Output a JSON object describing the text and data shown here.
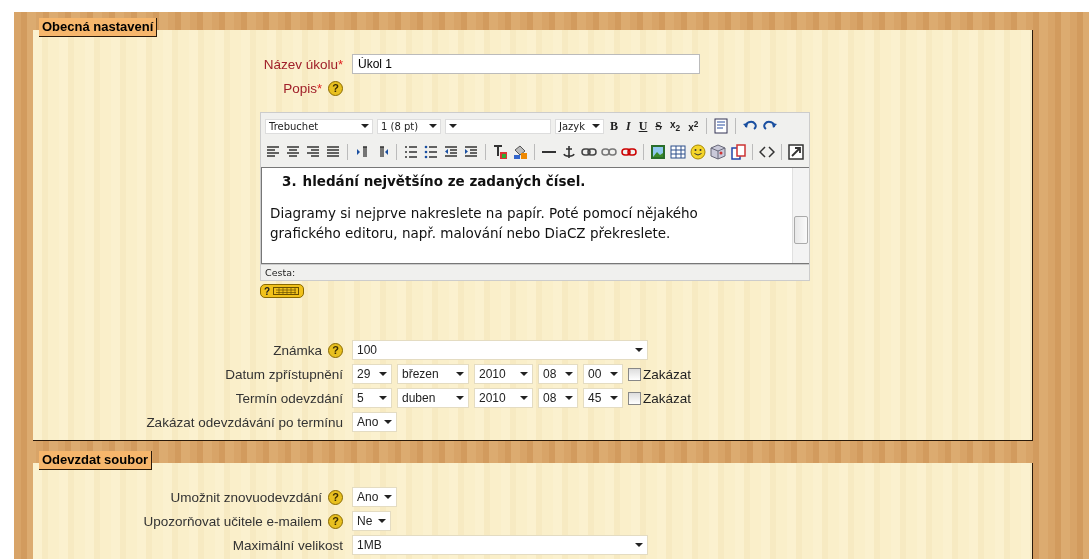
{
  "sections": [
    {
      "legend": "Obecná nastavení",
      "rows": [
        {
          "kind": "text",
          "label": "Název úkolu",
          "required_mark": "*",
          "value": "Úkol 1"
        },
        {
          "kind": "editor",
          "label": "Popis",
          "required_mark": "*",
          "help": "?"
        },
        {
          "kind": "wide-select",
          "label": "Známka",
          "help": "?",
          "selects": [
            "100"
          ]
        },
        {
          "kind": "date",
          "label": "Datum zpřístupnění",
          "selects": [
            "29",
            "březen",
            "2010",
            "08",
            "00"
          ],
          "checkbox": {
            "label": "Zakázat",
            "checked": false
          }
        },
        {
          "kind": "date",
          "label": "Termín odevzdání",
          "selects": [
            "5",
            "duben",
            "2010",
            "08",
            "45"
          ],
          "checkbox": {
            "label": "Zakázat",
            "checked": false
          }
        },
        {
          "kind": "select",
          "label": "Zakázat odevzdávání po termínu",
          "selects": [
            "Ano"
          ]
        }
      ]
    },
    {
      "legend": "Odevzdat soubor",
      "rows": [
        {
          "kind": "select",
          "label": "Umožnit znovuodevzdání",
          "help": "?",
          "selects": [
            "Ano"
          ]
        },
        {
          "kind": "select",
          "label": "Upozorňovat učitele e-mailem",
          "help": "?",
          "selects": [
            "Ne"
          ]
        },
        {
          "kind": "wide-select",
          "label": "Maximální velikost",
          "selects": [
            "1MB"
          ]
        }
      ]
    }
  ],
  "editor": {
    "dropdowns": [
      {
        "kind": "font",
        "value": "Trebuchet"
      },
      {
        "kind": "size",
        "value": "1 (8 pt)"
      },
      {
        "kind": "format"
      },
      {
        "kind": "language",
        "value": "Jazyk"
      }
    ],
    "format_buttons": [
      {
        "kind": "bold",
        "label": "B"
      },
      {
        "kind": "italic",
        "label": "I"
      },
      {
        "kind": "underline",
        "label": "U"
      },
      {
        "kind": "strike",
        "label": "S"
      },
      {
        "kind": "script",
        "label": "x$_{2}$"
      },
      {
        "kind": "script",
        "label": "x$^{2}$"
      }
    ],
    "list_item": {
      "number": "3.",
      "text": "hledání největšíno ze zadaných čísel."
    },
    "paragraph": "Diagramy si nejprve nakreslete na papír. Poté pomocí nějakého grafického editoru, např. malování nebo DiaCZ překreslete.",
    "path_label": "Cesta:",
    "keyboard_help": "?"
  }
}
